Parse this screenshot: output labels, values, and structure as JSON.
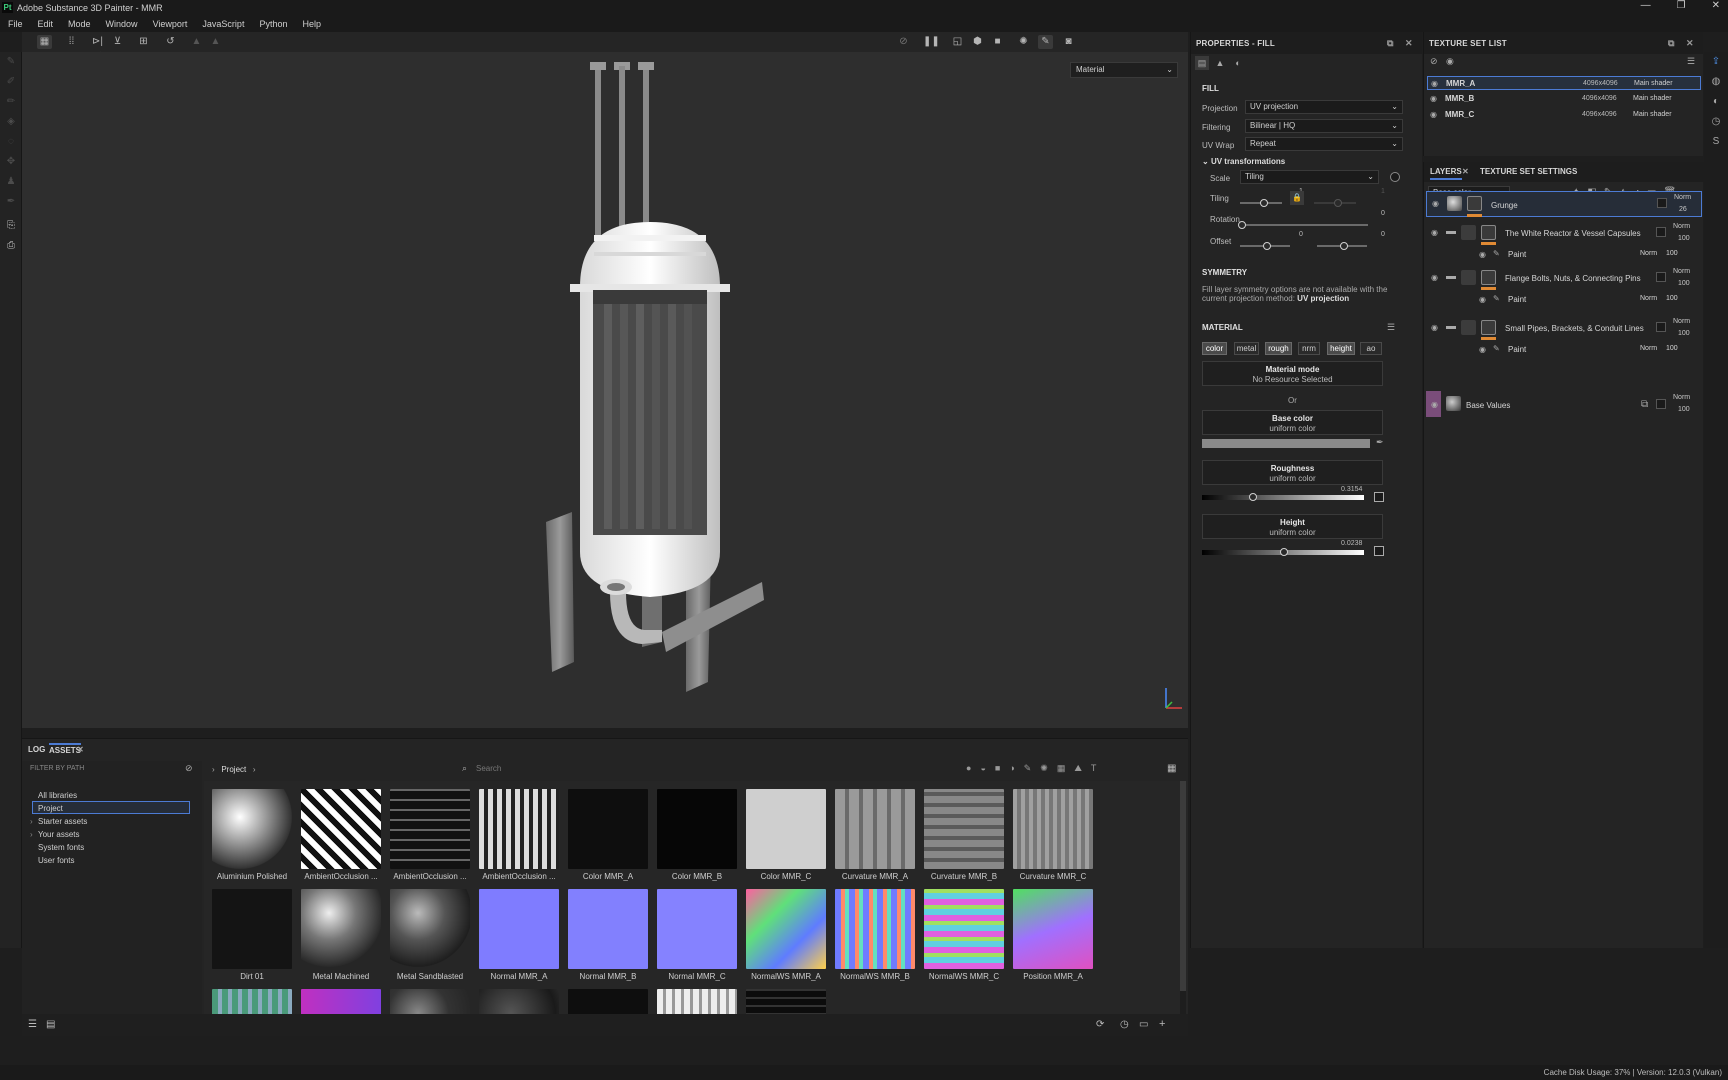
{
  "window": {
    "title": "Adobe Substance 3D Painter - MMR",
    "logo": "Pt"
  },
  "menu": [
    "File",
    "Edit",
    "Mode",
    "Window",
    "Viewport",
    "JavaScript",
    "Python",
    "Help"
  ],
  "viewport": {
    "mode": "Material"
  },
  "properties": {
    "title": "PROPERTIES - FILL",
    "fill_section": "FILL",
    "projection_label": "Projection",
    "projection_value": "UV projection",
    "filtering_label": "Filtering",
    "filtering_value": "Bilinear | HQ",
    "uvwrap_label": "UV Wrap",
    "uvwrap_value": "Repeat",
    "uvtrans_label": "UV transformations",
    "scale_label": "Scale",
    "scale_value": "Tiling",
    "tiling_label": "Tiling",
    "tiling_val1": "1",
    "tiling_val2": "1",
    "rotation_label": "Rotation",
    "rotation_val": "0",
    "offset_label": "Offset",
    "offset_val1": "0",
    "offset_val2": "0",
    "symmetry_section": "SYMMETRY",
    "symmetry_note1": "Fill layer symmetry options are not available with the",
    "symmetry_note2": "current projection method:",
    "symmetry_method": "UV projection",
    "material_section": "MATERIAL",
    "channels": [
      {
        "label": "color",
        "on": true
      },
      {
        "label": "metal",
        "on": false
      },
      {
        "label": "rough",
        "on": true
      },
      {
        "label": "nrm",
        "on": false
      },
      {
        "label": "height",
        "on": true
      },
      {
        "label": "ao",
        "on": false
      }
    ],
    "material_mode_title": "Material mode",
    "material_mode_sub": "No Resource Selected",
    "or": "Or",
    "basecolor_title": "Base color",
    "basecolor_sub": "uniform color",
    "roughness_title": "Roughness",
    "roughness_sub": "uniform color",
    "roughness_value": "0.3154",
    "height_title": "Height",
    "height_sub": "uniform color",
    "height_value": "0.0238"
  },
  "texture_sets": {
    "title": "TEXTURE SET LIST",
    "rows": [
      {
        "name": "MMR_A",
        "res": "4096x4096",
        "shader": "Main shader"
      },
      {
        "name": "MMR_B",
        "res": "4096x4096",
        "shader": "Main shader"
      },
      {
        "name": "MMR_C",
        "res": "4096x4096",
        "shader": "Main shader"
      }
    ]
  },
  "layers": {
    "tab1": "LAYERS",
    "tab2": "TEXTURE SET SETTINGS",
    "channel": "Base color",
    "items": [
      {
        "name": "Grunge",
        "blend": "Norm",
        "opacity": "26"
      },
      {
        "name": "The White Reactor & Vessel Capsules",
        "blend": "Norm",
        "opacity": "100",
        "sub": "Paint",
        "sub_blend": "Norm",
        "sub_op": "100"
      },
      {
        "name": "Flange Bolts, Nuts, & Connecting Pins",
        "blend": "Norm",
        "opacity": "100",
        "sub": "Paint",
        "sub_blend": "Norm",
        "sub_op": "100"
      },
      {
        "name": "Small Pipes, Brackets, & Conduit Lines",
        "blend": "Norm",
        "opacity": "100",
        "sub": "Paint",
        "sub_blend": "Norm",
        "sub_op": "100"
      },
      {
        "name": "Base Values",
        "blend": "Norm",
        "opacity": "100"
      }
    ]
  },
  "assets": {
    "tab_log": "LOG",
    "tab_assets": "ASSETS",
    "filter_placeholder": "FILTER BY PATH",
    "breadcrumb": "Project",
    "search_placeholder": "Search",
    "libraries": [
      "All libraries",
      "Project",
      "Starter assets",
      "Your assets",
      "System fonts",
      "User fonts"
    ],
    "tiles": [
      "Aluminium Polished",
      "AmbientOcclusion ...",
      "AmbientOcclusion ...",
      "AmbientOcclusion ...",
      "Color MMR_A",
      "Color MMR_B",
      "Color MMR_C",
      "Curvature MMR_A",
      "Curvature MMR_B",
      "Curvature MMR_C",
      "Dirt 01",
      "Metal Machined",
      "Metal Sandblasted",
      "Normal MMR_A",
      "Normal MMR_B",
      "Normal MMR_C",
      "NormalWS MMR_A",
      "NormalWS MMR_B",
      "NormalWS MMR_C",
      "Position MMR_A"
    ]
  },
  "status": "Cache Disk Usage:  37% | Version: 12.0.3 (Vulkan)"
}
